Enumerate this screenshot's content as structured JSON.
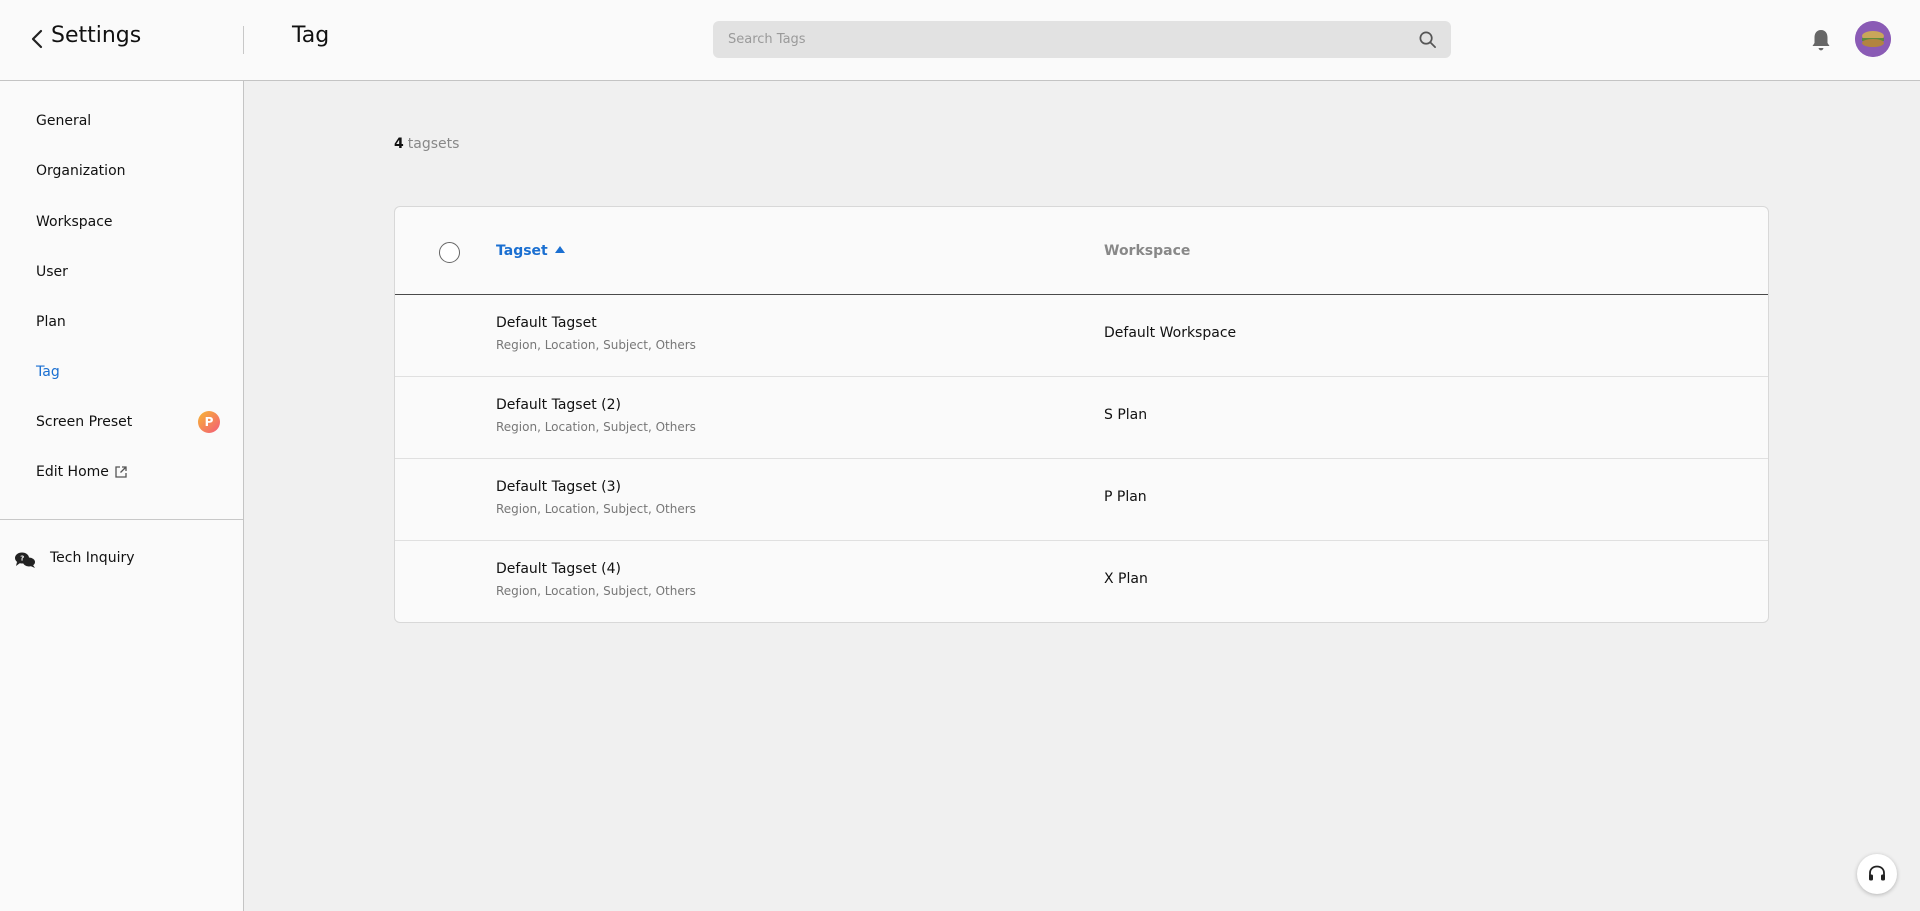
{
  "header": {
    "back_title": "Settings",
    "page_title": "Tag",
    "search_placeholder": "Search Tags"
  },
  "sidebar": {
    "items": [
      {
        "label": "General"
      },
      {
        "label": "Organization"
      },
      {
        "label": "Workspace"
      },
      {
        "label": "User"
      },
      {
        "label": "Plan"
      },
      {
        "label": "Tag",
        "active": true
      },
      {
        "label": "Screen Preset",
        "badge": "P"
      },
      {
        "label": "Edit Home",
        "icon": "external-link-icon"
      }
    ],
    "footer_label": "Tech Inquiry"
  },
  "main": {
    "count_value": "4",
    "count_label": "tagsets",
    "table": {
      "columns": [
        "Tagset",
        "Workspace"
      ],
      "rows": [
        {
          "name": "Default Tagset",
          "sub": "Region, Location, Subject, Others",
          "workspace": "Default Workspace"
        },
        {
          "name": "Default Tagset (2)",
          "sub": "Region, Location, Subject, Others",
          "workspace": "S Plan"
        },
        {
          "name": "Default Tagset (3)",
          "sub": "Region, Location, Subject, Others",
          "workspace": "P Plan"
        },
        {
          "name": "Default Tagset (4)",
          "sub": "Region, Location, Subject, Others",
          "workspace": "X Plan"
        }
      ]
    }
  },
  "colors": {
    "accent": "#1a6fd1",
    "badge_gradient_start": "#f7b733",
    "badge_gradient_end": "#f35a7a",
    "avatar_bg": "#8a5bb5"
  }
}
